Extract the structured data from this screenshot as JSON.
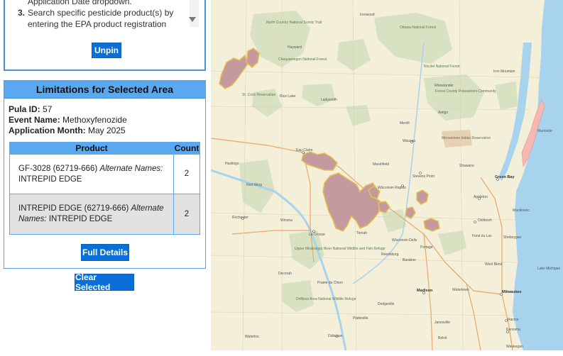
{
  "instructions": {
    "prev_line": "Application Date dropdown.",
    "item3_num": "3.",
    "item3_text": "Search specific pesticide product(s) by entering the EPA product registration"
  },
  "unpin_label": "Unpin",
  "limitations": {
    "title": "Limitations for Selected Area",
    "pula_id_label": "Pula ID:",
    "pula_id": "57",
    "event_name_label": "Event Name:",
    "event_name": "Methoxyfenozide",
    "application_month_label": "Application Month:",
    "application_month": "May 2025",
    "table": {
      "col_product": "Product",
      "col_count": "Count",
      "rows": [
        {
          "product": "GF-3028 (62719-666)",
          "alt_label": "Alternate Names:",
          "alt": "INTREPID EDGE",
          "count": "2"
        },
        {
          "product": "INTREPID EDGE (62719-666)",
          "alt_label": "Alternate Names:",
          "alt": "INTREPID EDGE",
          "count": "2"
        }
      ]
    },
    "full_details_label": "Full Details"
  },
  "clear_selected_label": "Clear Selected",
  "map": {
    "labels": {
      "rochester": "Rochester",
      "la_crosse": "La Crosse",
      "eau_claire": "Eau Claire",
      "wausau": "Wausau",
      "stevens_point": "Stevens Point",
      "wisconsin_rapids": "Wisconsin Rapids",
      "appleton": "Appleton",
      "green_bay": "Green Bay",
      "oshkosh": "Oshkosh",
      "fond_du_lac": "Fond du Lac",
      "sheboygan": "Sheboygan",
      "madison": "Madison",
      "milwaukee": "Milwaukee",
      "racine": "Racine",
      "kenosha": "Kenosha",
      "waukegan": "Waukegan",
      "dubuque": "Dubuque",
      "waterloo": "Waterloo",
      "decorah": "Decorah",
      "rhinelander": "Rhinelander",
      "merrill": "Merrill",
      "marshfield": "Marshfield",
      "baraboo": "Baraboo",
      "janesville": "Janesville",
      "west_bend": "West Bend",
      "manitowoc": "Manitowoc",
      "marinette": "Marinette",
      "ironwood": "Ironwood",
      "iron_mountain": "Iron Mountain",
      "lake_michigan": "Lake Michigan",
      "nicolet": "Nicolet National Forest",
      "ottawa": "Ottawa National Forest",
      "chequamegon": "Chequamegon National Forest",
      "north_country": "North Country National Scenic Trail",
      "upper_miss": "Upper Mississippi River National Wildlife and Fish Refuge",
      "driftless": "Driftless Area National Wildlife Refuge",
      "menominee": "Menominee Indian Reservation",
      "forest_county": "Forest County Potawatomi Community",
      "st_croix": "St. Croix Reservation",
      "rice_lake": "Rice Lake",
      "ladysmith": "Ladysmith",
      "hayward": "Hayward",
      "reedsburg": "Reedsburg",
      "portage": "Portage",
      "watertown": "Watertown",
      "beloit": "Beloit",
      "hastings": "Hastings",
      "red_wing": "Red Wing",
      "winona": "Winona",
      "platteville": "Platteville",
      "dodgeville": "Dodgeville",
      "prairie_du_chien": "Prairie du Chien",
      "tomah": "Tomah",
      "wisconsin_dells": "Wisconsin Dells",
      "shawano": "Shawano",
      "antigo": "Antigo"
    },
    "colors": {
      "base": "#f3efd8",
      "forest": "#d8e2c2",
      "water": "#a8d3ee",
      "pula_fill": "#c49aa0",
      "pula_stroke": "#e2c24a",
      "pink_zone": "#f7b8b4"
    }
  }
}
